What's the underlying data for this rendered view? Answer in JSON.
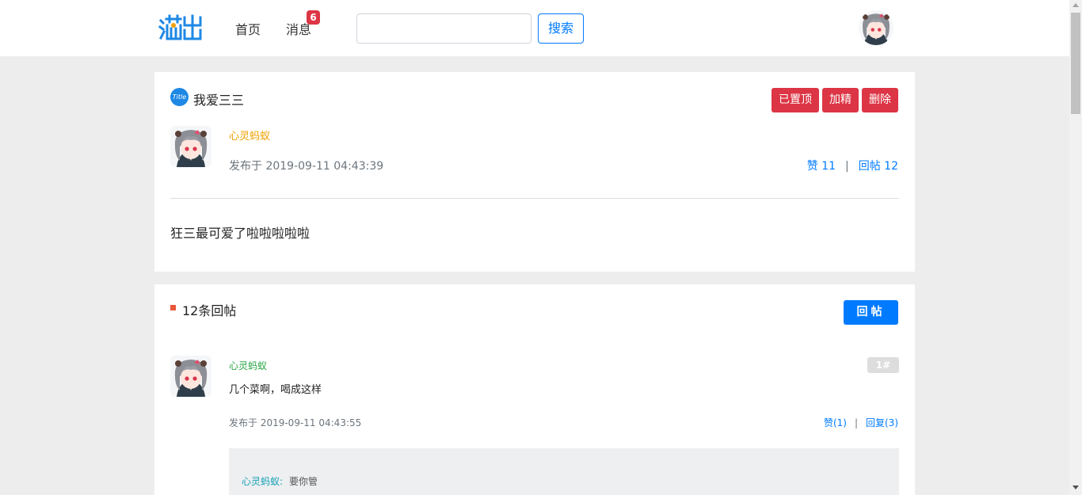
{
  "header": {
    "nav_home": "首页",
    "nav_messages": "消息",
    "message_count": "6",
    "search_placeholder": "",
    "search_button": "搜索",
    "logo_icon": "brand-logo-icon",
    "avatar_icon": "anime-avatar-icon"
  },
  "post": {
    "title_icon_text": "Title",
    "title": "我爱三三",
    "buttons": {
      "pinned": "已置顶",
      "essence": "加精",
      "delete": "删除"
    },
    "author": "心灵蚂蚁",
    "published": "发布于 2019-09-11 04:43:39",
    "likes_label": "赞 11",
    "stat_separator": "|",
    "replies_label": "回帖 12",
    "content": "狂三最可爱了啦啦啦啦啦"
  },
  "replies": {
    "title": "12条回帖",
    "reply_button": "回帖",
    "items": [
      {
        "author": "心灵蚂蚁",
        "floor": "1#",
        "content": "几个菜啊，喝成这样",
        "published": "发布于 2019-09-11 04:43:55",
        "likes_label": "赞(1)",
        "separator": "|",
        "reply_label": "回复(3)",
        "sub_replies": [
          {
            "author": "心灵蚂蚁:",
            "content": "要你管"
          }
        ]
      }
    ]
  },
  "colors": {
    "primary": "#007bff",
    "danger": "#dc3545",
    "author_post": "#f0a000",
    "author_reply": "#28a745",
    "author_sub": "#17a2b8",
    "background": "#ededed"
  }
}
